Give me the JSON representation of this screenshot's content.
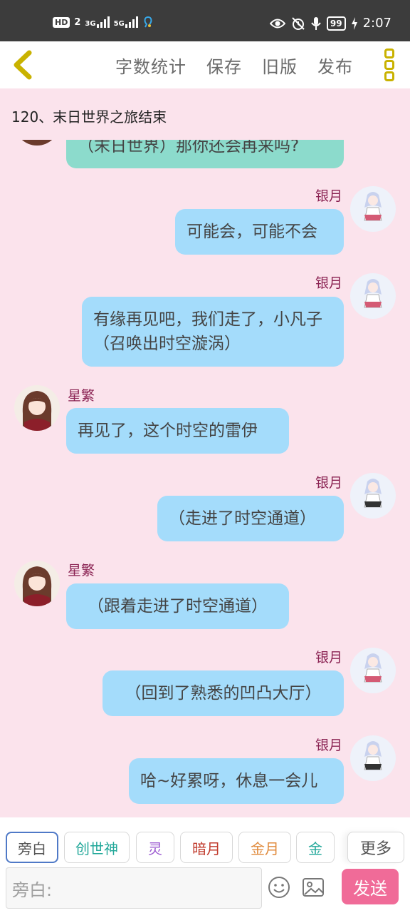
{
  "status_bar": {
    "hd": "HD",
    "sim": "2",
    "signal1": "3G",
    "signal2": "5G",
    "battery": "99",
    "time": "2:07",
    "icons": [
      "eye-icon",
      "alarm-icon",
      "mic-icon",
      "charging-icon"
    ]
  },
  "toolbar": {
    "back_icon": "chevron-left-icon",
    "actions": [
      "字数统计",
      "保存",
      "旧版",
      "发布"
    ],
    "menu_icon": "more-vertical-icon",
    "accent": "#c9b200"
  },
  "chapter_title": "120、末日世界之旅结束",
  "messages": [
    {
      "speaker": "",
      "side": "left",
      "text": "（末日世界）那你还会再来吗?",
      "color": "#8cdbcc"
    },
    {
      "speaker": "银月",
      "side": "right",
      "text": "可能会，可能不会"
    },
    {
      "speaker": "银月",
      "side": "right",
      "text": "有缘再见吧，我们走了，小凡子（召唤出时空漩涡）"
    },
    {
      "speaker": "星繁",
      "side": "left",
      "text": "再见了，这个时空的雷伊"
    },
    {
      "speaker": "银月",
      "side": "right",
      "text": "（走进了时空通道）"
    },
    {
      "speaker": "星繁",
      "side": "left",
      "text": "（跟着走进了时空通道）"
    },
    {
      "speaker": "银月",
      "side": "right",
      "text": "（回到了熟悉的凹凸大厅）"
    },
    {
      "speaker": "银月",
      "side": "right",
      "text": "哈~好累呀，休息一会儿"
    }
  ],
  "roles": [
    {
      "label": "旁白",
      "color": "#555555",
      "active": true
    },
    {
      "label": "创世神",
      "color": "#23a89a"
    },
    {
      "label": "灵",
      "color": "#9b59d0"
    },
    {
      "label": "暗月",
      "color": "#c0392b"
    },
    {
      "label": "金月",
      "color": "#e08a3c"
    },
    {
      "label": "金",
      "color": "#23a89a"
    }
  ],
  "more_label": "更多",
  "input": {
    "placeholder": "旁白:",
    "emoji_icon": "emoji-icon",
    "image_icon": "image-icon"
  },
  "send_label": "发送",
  "bubble_color": "#a4dcfb",
  "name_color": "#8a2252"
}
